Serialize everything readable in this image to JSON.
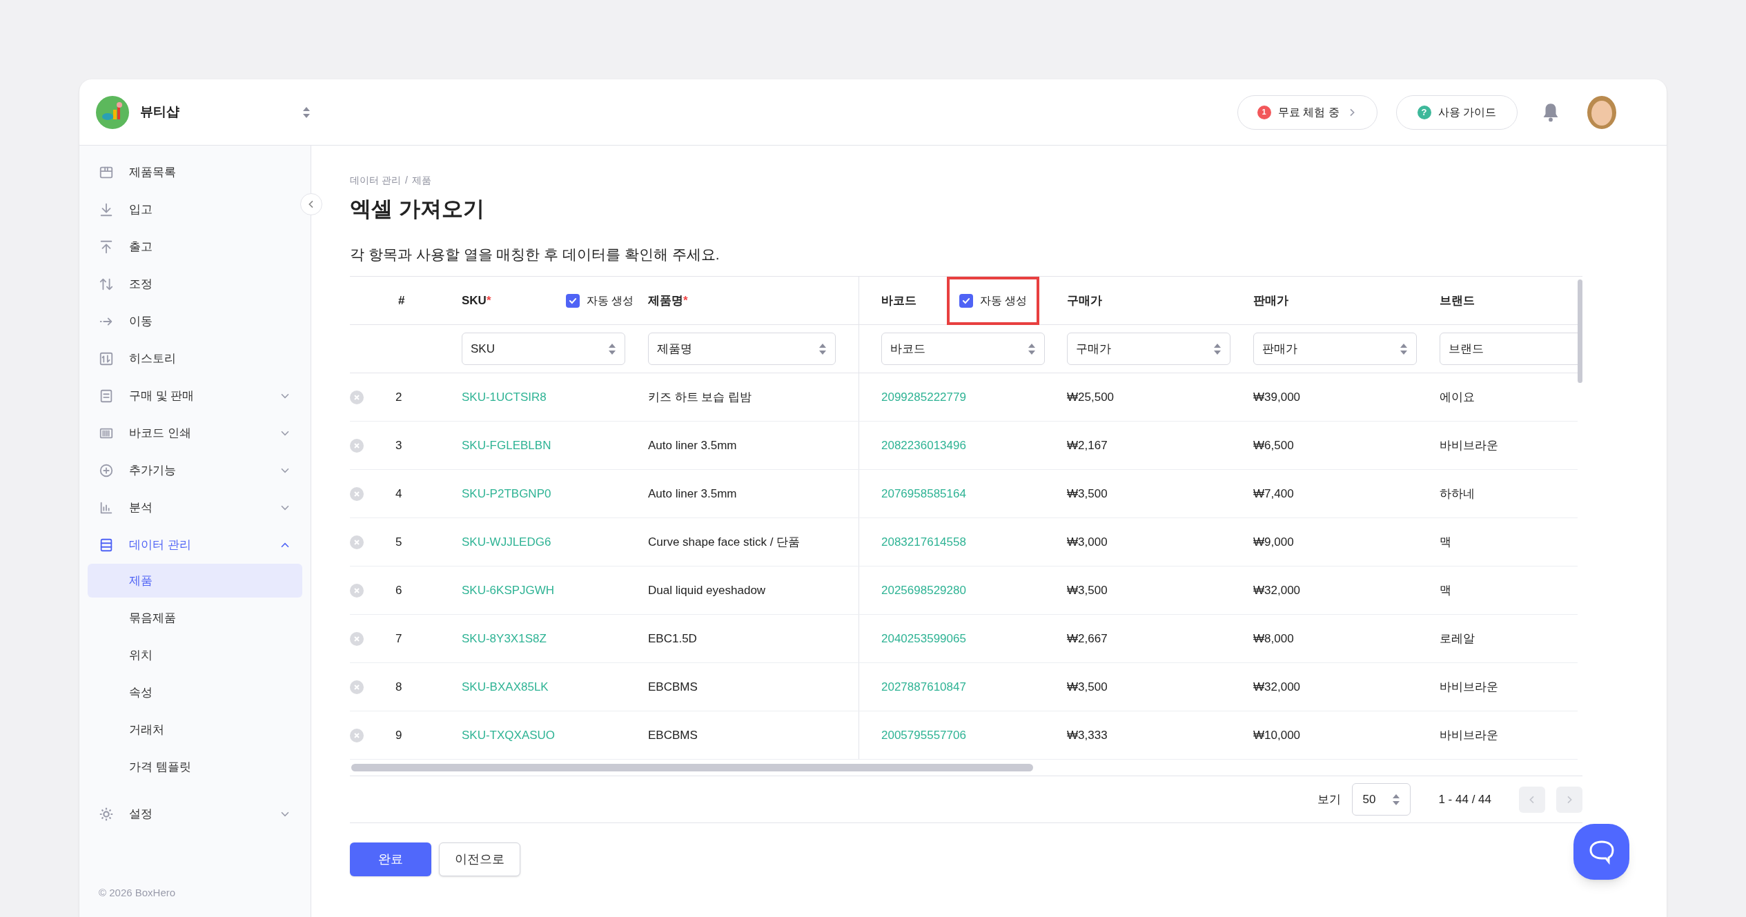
{
  "header": {
    "shop_name": "뷰티샵",
    "trial": {
      "badge": "1",
      "label": "무료 체험 중"
    },
    "guide": {
      "badge": "?",
      "label": "사용 가이드"
    }
  },
  "sidebar": {
    "items": [
      {
        "kind": "link",
        "label": "제품목록",
        "selected": false
      },
      {
        "kind": "link",
        "label": "입고",
        "selected": false
      },
      {
        "kind": "link",
        "label": "출고",
        "selected": false
      },
      {
        "kind": "link",
        "label": "조정",
        "selected": false
      },
      {
        "kind": "link",
        "label": "이동",
        "selected": false
      },
      {
        "kind": "link",
        "label": "히스토리",
        "selected": false
      },
      {
        "kind": "group",
        "label": "구매 및 판매",
        "selected": false,
        "expanded": false
      },
      {
        "kind": "group",
        "label": "바코드 인쇄",
        "selected": false,
        "expanded": false
      },
      {
        "kind": "group",
        "label": "추가기능",
        "selected": false,
        "expanded": false
      },
      {
        "kind": "group",
        "label": "분석",
        "selected": false,
        "expanded": false
      },
      {
        "kind": "group",
        "label": "데이터 관리",
        "selected": true,
        "expanded": true,
        "children": [
          {
            "label": "제품",
            "selected": true
          },
          {
            "label": "묶음제품",
            "selected": false
          },
          {
            "label": "위치",
            "selected": false
          },
          {
            "label": "속성",
            "selected": false
          },
          {
            "label": "거래처",
            "selected": false
          },
          {
            "label": "가격 템플릿",
            "selected": false
          }
        ]
      }
    ],
    "settings": {
      "label": "설정",
      "expanded": false
    },
    "copyright": "© 2026 BoxHero"
  },
  "breadcrumb": [
    "데이터 관리",
    "/",
    "제품"
  ],
  "title": "엑셀 가져오기",
  "instruction": "각 항목과 사용할 열을 매칭한 후 데이터를 확인해 주세요.",
  "table": {
    "columns": [
      {
        "label": "#"
      },
      {
        "label": "SKU",
        "required_mark": "*",
        "auto_generate": {
          "label": "자동 생성",
          "checked": true,
          "highlighted": false
        },
        "mapping": "SKU"
      },
      {
        "label": "제품명",
        "required_mark": "*",
        "mapping": "제품명"
      },
      {
        "label": "바코드",
        "auto_generate": {
          "label": "자동 생성",
          "checked": true,
          "highlighted": true
        },
        "mapping": "바코드"
      },
      {
        "label": "구매가",
        "mapping": "구매가"
      },
      {
        "label": "판매가",
        "mapping": "판매가"
      },
      {
        "label": "브랜드",
        "mapping": "브랜드"
      }
    ],
    "rows": [
      [
        "2",
        "SKU-1UCTSIR8",
        "키즈 하트 보습 립밤",
        "2099285222779",
        "₩25,500",
        "₩39,000",
        "에이요"
      ],
      [
        "3",
        "SKU-FGLEBLBN",
        "Auto liner 3.5mm",
        "2082236013496",
        "₩2,167",
        "₩6,500",
        "바비브라운"
      ],
      [
        "4",
        "SKU-P2TBGNP0",
        "Auto liner 3.5mm",
        "2076958585164",
        "₩3,500",
        "₩7,400",
        "하하네"
      ],
      [
        "5",
        "SKU-WJJLEDG6",
        "Curve shape face stick / 단품",
        "2083217614558",
        "₩3,000",
        "₩9,000",
        "맥"
      ],
      [
        "6",
        "SKU-6KSPJGWH",
        "Dual liquid eyeshadow",
        "2025698529280",
        "₩3,500",
        "₩32,000",
        "맥"
      ],
      [
        "7",
        "SKU-8Y3X1S8Z",
        "EBC1.5D",
        "2040253599065",
        "₩2,667",
        "₩8,000",
        "로레알"
      ],
      [
        "8",
        "SKU-BXAX85LK",
        "EBCBMS",
        "2027887610847",
        "₩3,500",
        "₩32,000",
        "바비브라운"
      ],
      [
        "9",
        "SKU-TXQXASUO",
        "EBCBMS",
        "2005795557706",
        "₩3,333",
        "₩10,000",
        "바비브라운"
      ]
    ]
  },
  "pagination": {
    "label": "보기",
    "page_size": "50",
    "range": "1 - 44 / 44",
    "prev_disabled": true,
    "next_disabled": true
  },
  "buttons": [
    {
      "kind": "primary",
      "label": "완료"
    },
    {
      "kind": "secondary",
      "label": "이전으로"
    }
  ]
}
